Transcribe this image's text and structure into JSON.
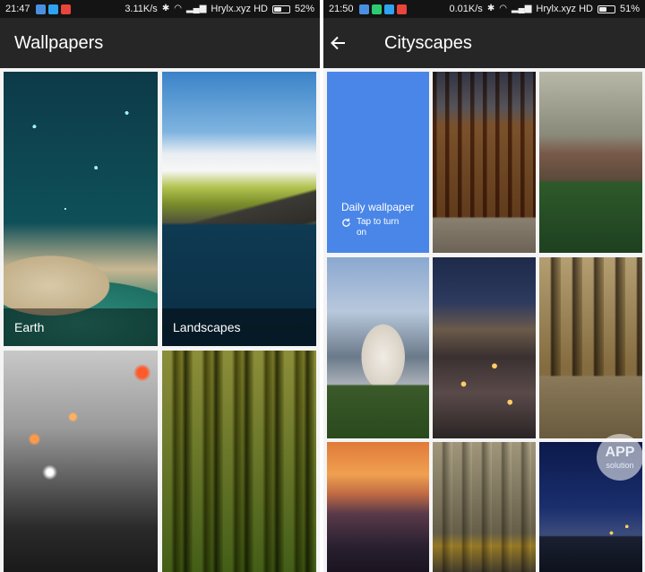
{
  "left": {
    "status": {
      "time": "21:47",
      "speed": "3.11K/s",
      "carrier": "Hrylx.xyz HD",
      "battery": "52%",
      "battery_level": 0.52,
      "notif_colors": [
        "#4a90e2",
        "#2ea3f2",
        "#e8453c"
      ]
    },
    "appbar": {
      "title": "Wallpapers"
    },
    "tiles": [
      {
        "label": "Earth"
      },
      {
        "label": "Landscapes"
      }
    ]
  },
  "right": {
    "status": {
      "time": "21:50",
      "speed": "0.01K/s",
      "carrier": "Hrylx.xyz HD",
      "battery": "51%",
      "battery_level": 0.51,
      "notif_colors": [
        "#4a90e2",
        "#2ecc71",
        "#2ea3f2",
        "#e8453c"
      ]
    },
    "appbar": {
      "title": "Cityscapes",
      "back_icon": "arrow-left-icon"
    },
    "daily": {
      "title": "Daily wallpaper",
      "subtitle": "Tap to turn on",
      "icon": "refresh-icon",
      "color": "#4a86e8"
    }
  },
  "watermark": {
    "top": "APP",
    "bottom": "solution"
  }
}
